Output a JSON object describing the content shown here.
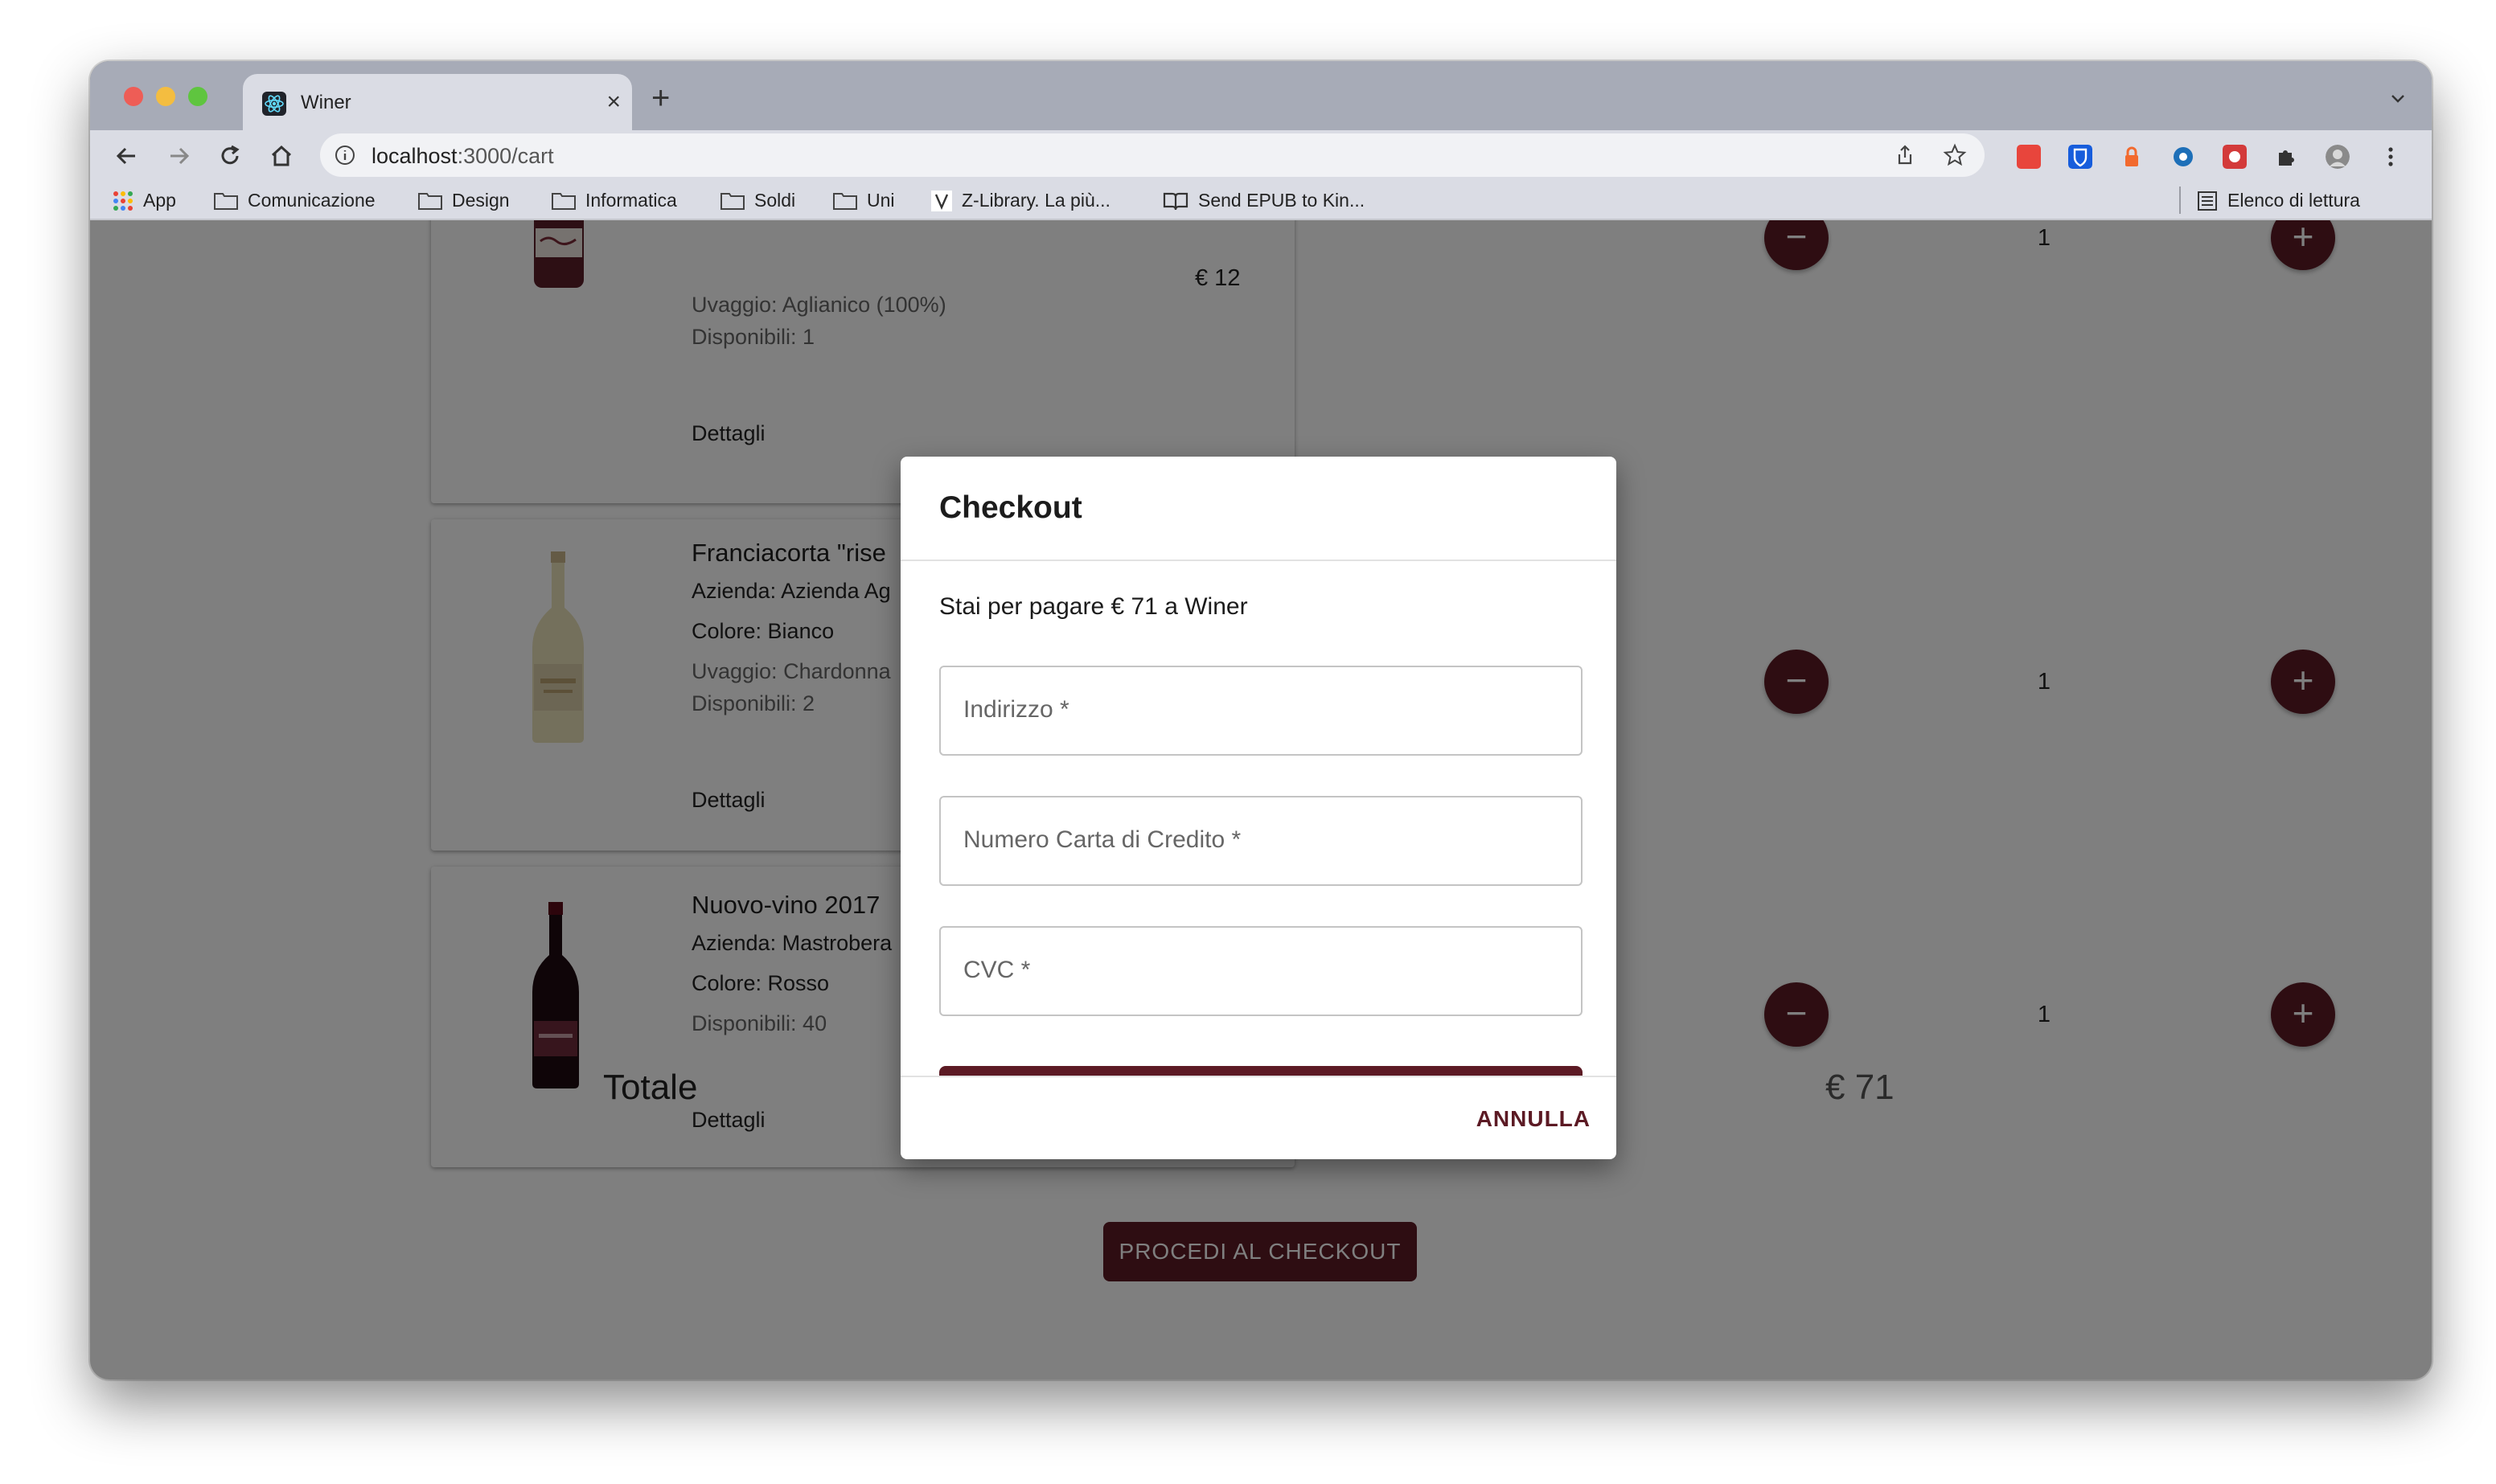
{
  "browser": {
    "tab_title": "Winer",
    "url_host": "localhost",
    "url_path": ":3000/cart",
    "bookmarks": [
      "App",
      "Comunicazione",
      "Design",
      "Informatica",
      "Soldi",
      "Uni",
      "Z-Library. La più...",
      "Send EPUB to Kin..."
    ],
    "reading_list": "Elenco di lettura"
  },
  "cart": {
    "items": [
      {
        "title": "",
        "price": "€ 12",
        "lines": [
          "Uvaggio: Aglianico (100%)",
          "Disponibili: 1"
        ],
        "details": "Dettagli",
        "quantity": "1",
        "bottle_color": "#5a1e28"
      },
      {
        "title": "Franciacorta \"rise",
        "lines": [
          "Azienda: Azienda Ag",
          "Colore: Bianco",
          "Uvaggio: Chardonna",
          "Disponibili: 2"
        ],
        "details": "Dettagli",
        "quantity": "1",
        "bottle_color": "#e8e0b8"
      },
      {
        "title": "Nuovo-vino 2017",
        "lines": [
          "Azienda: Mastrobera",
          "Colore: Rosso",
          "Disponibili: 40"
        ],
        "details": "Dettagli",
        "quantity": "1",
        "bottle_color": "#1e0a10"
      }
    ],
    "total_label": "Totale",
    "total_value": "€ 71",
    "checkout_label": "PROCEDI AL CHECKOUT",
    "minus": "−",
    "plus": "+"
  },
  "dialog": {
    "title": "Checkout",
    "message": "Stai per pagare € 71 a Winer",
    "fields": [
      "Indirizzo *",
      "Numero Carta di Credito *",
      "CVC *"
    ],
    "cancel_label": "ANNULLA"
  },
  "colors": {
    "accent": "#5c1a24",
    "tabstrip": "#a7abb7",
    "toolbar": "#dadce4"
  }
}
